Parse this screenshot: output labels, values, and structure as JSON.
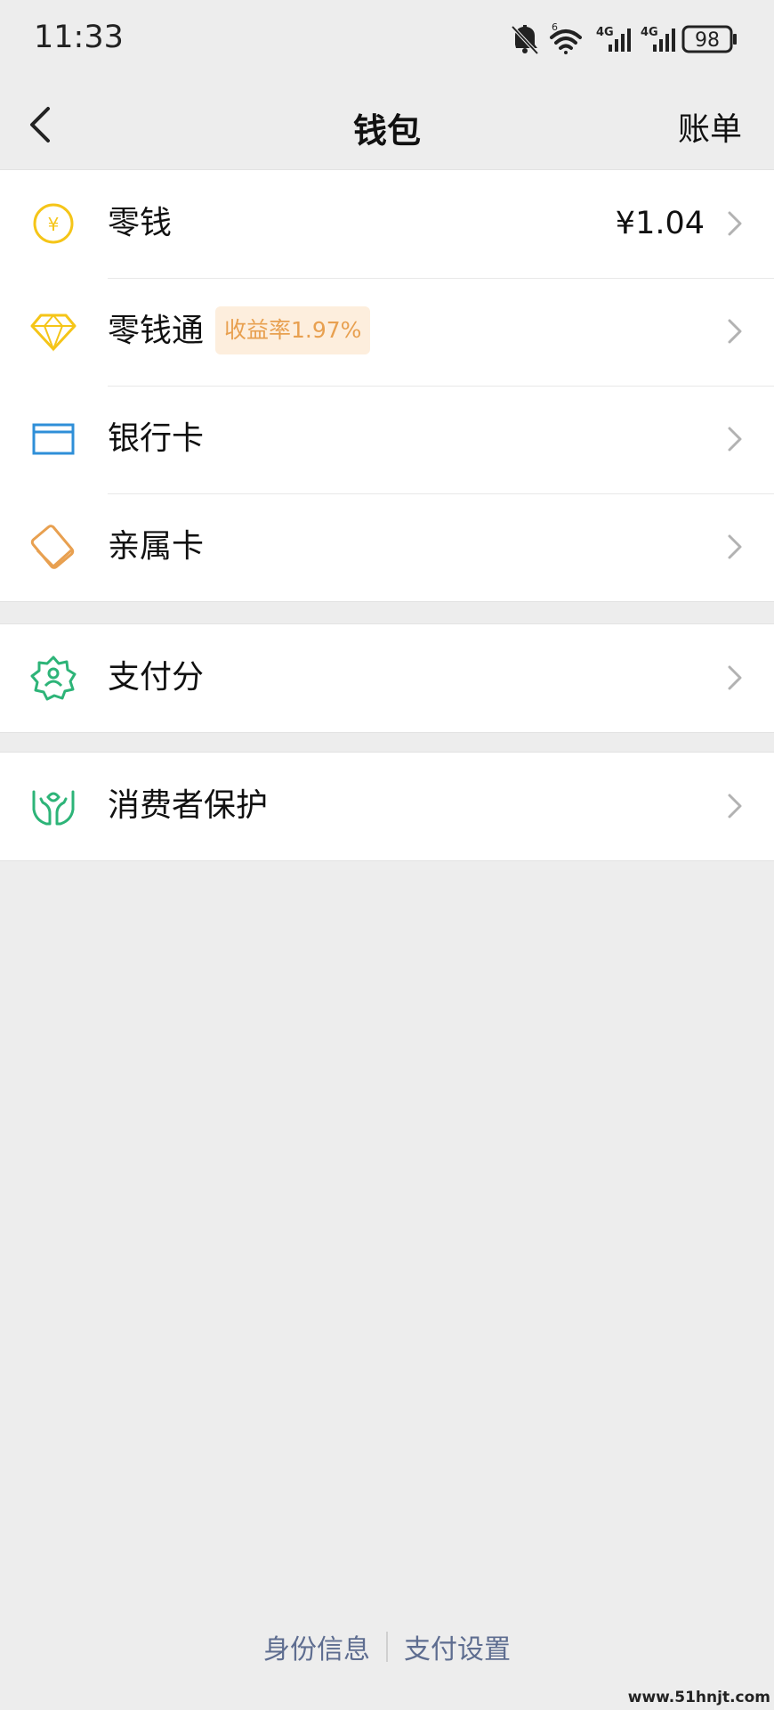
{
  "status_bar": {
    "time": "11:33",
    "signal_1_label": "4G",
    "signal_2_label": "4G",
    "wifi_label": "6",
    "battery": "98"
  },
  "nav": {
    "title": "钱包",
    "right_action": "账单"
  },
  "groups": [
    {
      "items": [
        {
          "label": "零钱",
          "value": "¥1.04",
          "icon": "coin-yuan-icon",
          "color": "#f5c518"
        },
        {
          "label": "零钱通",
          "badge": "收益率1.97%",
          "icon": "diamond-icon",
          "color": "#f5c518"
        },
        {
          "label": "银行卡",
          "icon": "bank-card-icon",
          "color": "#2f8fd8"
        },
        {
          "label": "亲属卡",
          "icon": "family-card-icon",
          "color": "#e8a050"
        }
      ]
    },
    {
      "items": [
        {
          "label": "支付分",
          "icon": "pay-score-icon",
          "color": "#2db478"
        }
      ]
    },
    {
      "items": [
        {
          "label": "消费者保护",
          "icon": "consumer-protection-icon",
          "color": "#2db478"
        }
      ]
    }
  ],
  "footer": {
    "link_1": "身份信息",
    "link_2": "支付设置"
  },
  "watermark": "www.51hnjt.com"
}
